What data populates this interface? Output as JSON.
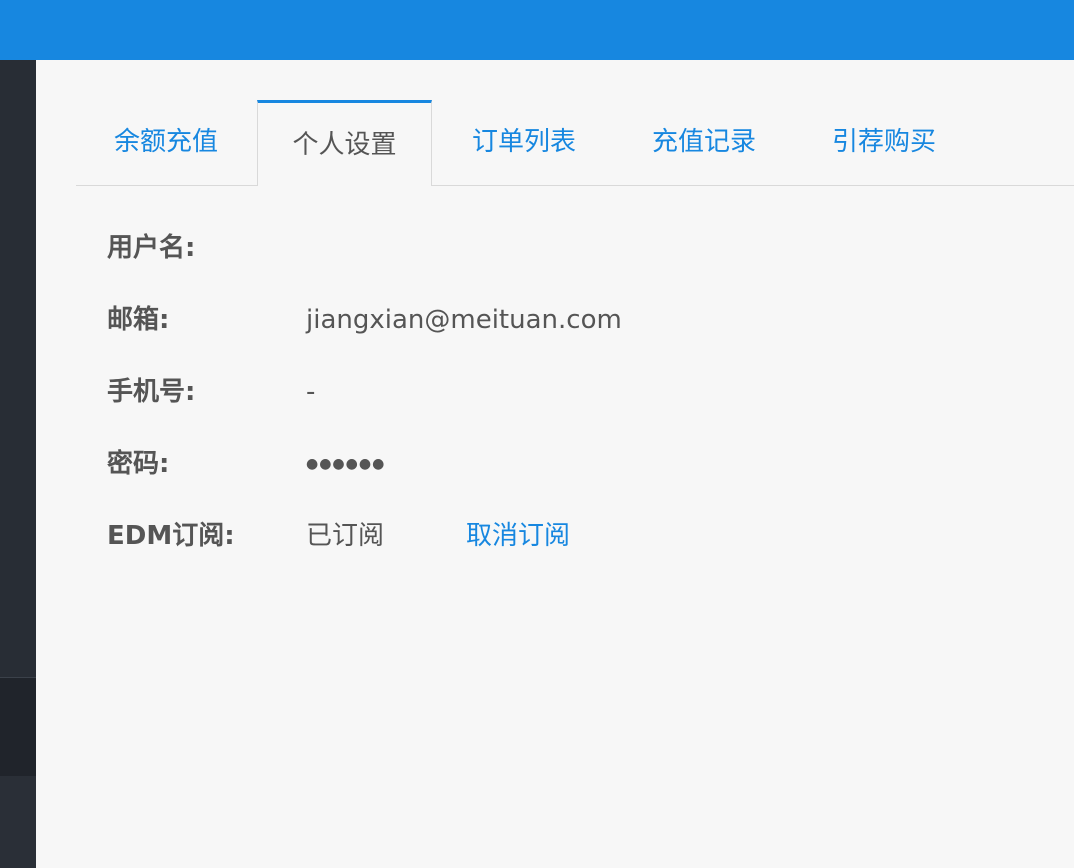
{
  "tabs": [
    {
      "label": "余额充值"
    },
    {
      "label": "个人设置"
    },
    {
      "label": "订单列表"
    },
    {
      "label": "充值记录"
    },
    {
      "label": "引荐购买"
    }
  ],
  "active_tab": "个人设置",
  "profile": {
    "username": {
      "label": "用户名:",
      "value": ""
    },
    "email": {
      "label": "邮箱:",
      "value": "jiangxian@meituan.com"
    },
    "phone": {
      "label": "手机号:",
      "value": "-"
    },
    "password": {
      "label": "密码:",
      "value": "●●●●●●"
    },
    "edm": {
      "label": "EDM订阅:",
      "value": "已订阅",
      "action": "取消订阅"
    }
  },
  "colors": {
    "accent": "#1787e0",
    "sidebar": "#282d35",
    "background": "#f7f7f7",
    "text": "#555555"
  }
}
